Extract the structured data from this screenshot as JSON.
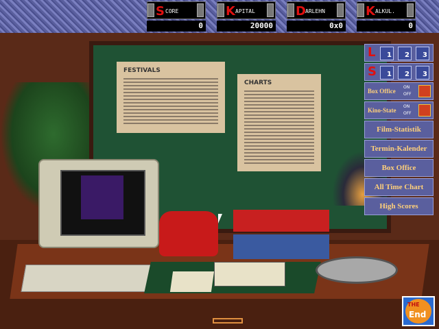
{
  "stats": [
    {
      "cap": "S",
      "rest": "CORE",
      "value": "0"
    },
    {
      "cap": "K",
      "rest": "APITAL",
      "value": "20000"
    },
    {
      "cap": "D",
      "rest": "ARLEHN",
      "value": "0x0"
    },
    {
      "cap": "K",
      "rest": "ALKUL.",
      "value": "0"
    }
  ],
  "posters": {
    "festivals": "FESTIVALS",
    "charts": "CHARTS"
  },
  "menu": {
    "load_letter": "L",
    "save_letter": "S",
    "slots": [
      "1",
      "2",
      "3"
    ],
    "box_office_toggle": "Box Office",
    "kino_state_toggle": "Kino-State",
    "on": "ON",
    "off": "OFF",
    "buttons": [
      "Film-Statistik",
      "Termin-Kalender",
      "Box Office",
      "All Time Chart",
      "High Scores"
    ]
  },
  "the_end": {
    "line1": "THE",
    "line2": "End"
  }
}
